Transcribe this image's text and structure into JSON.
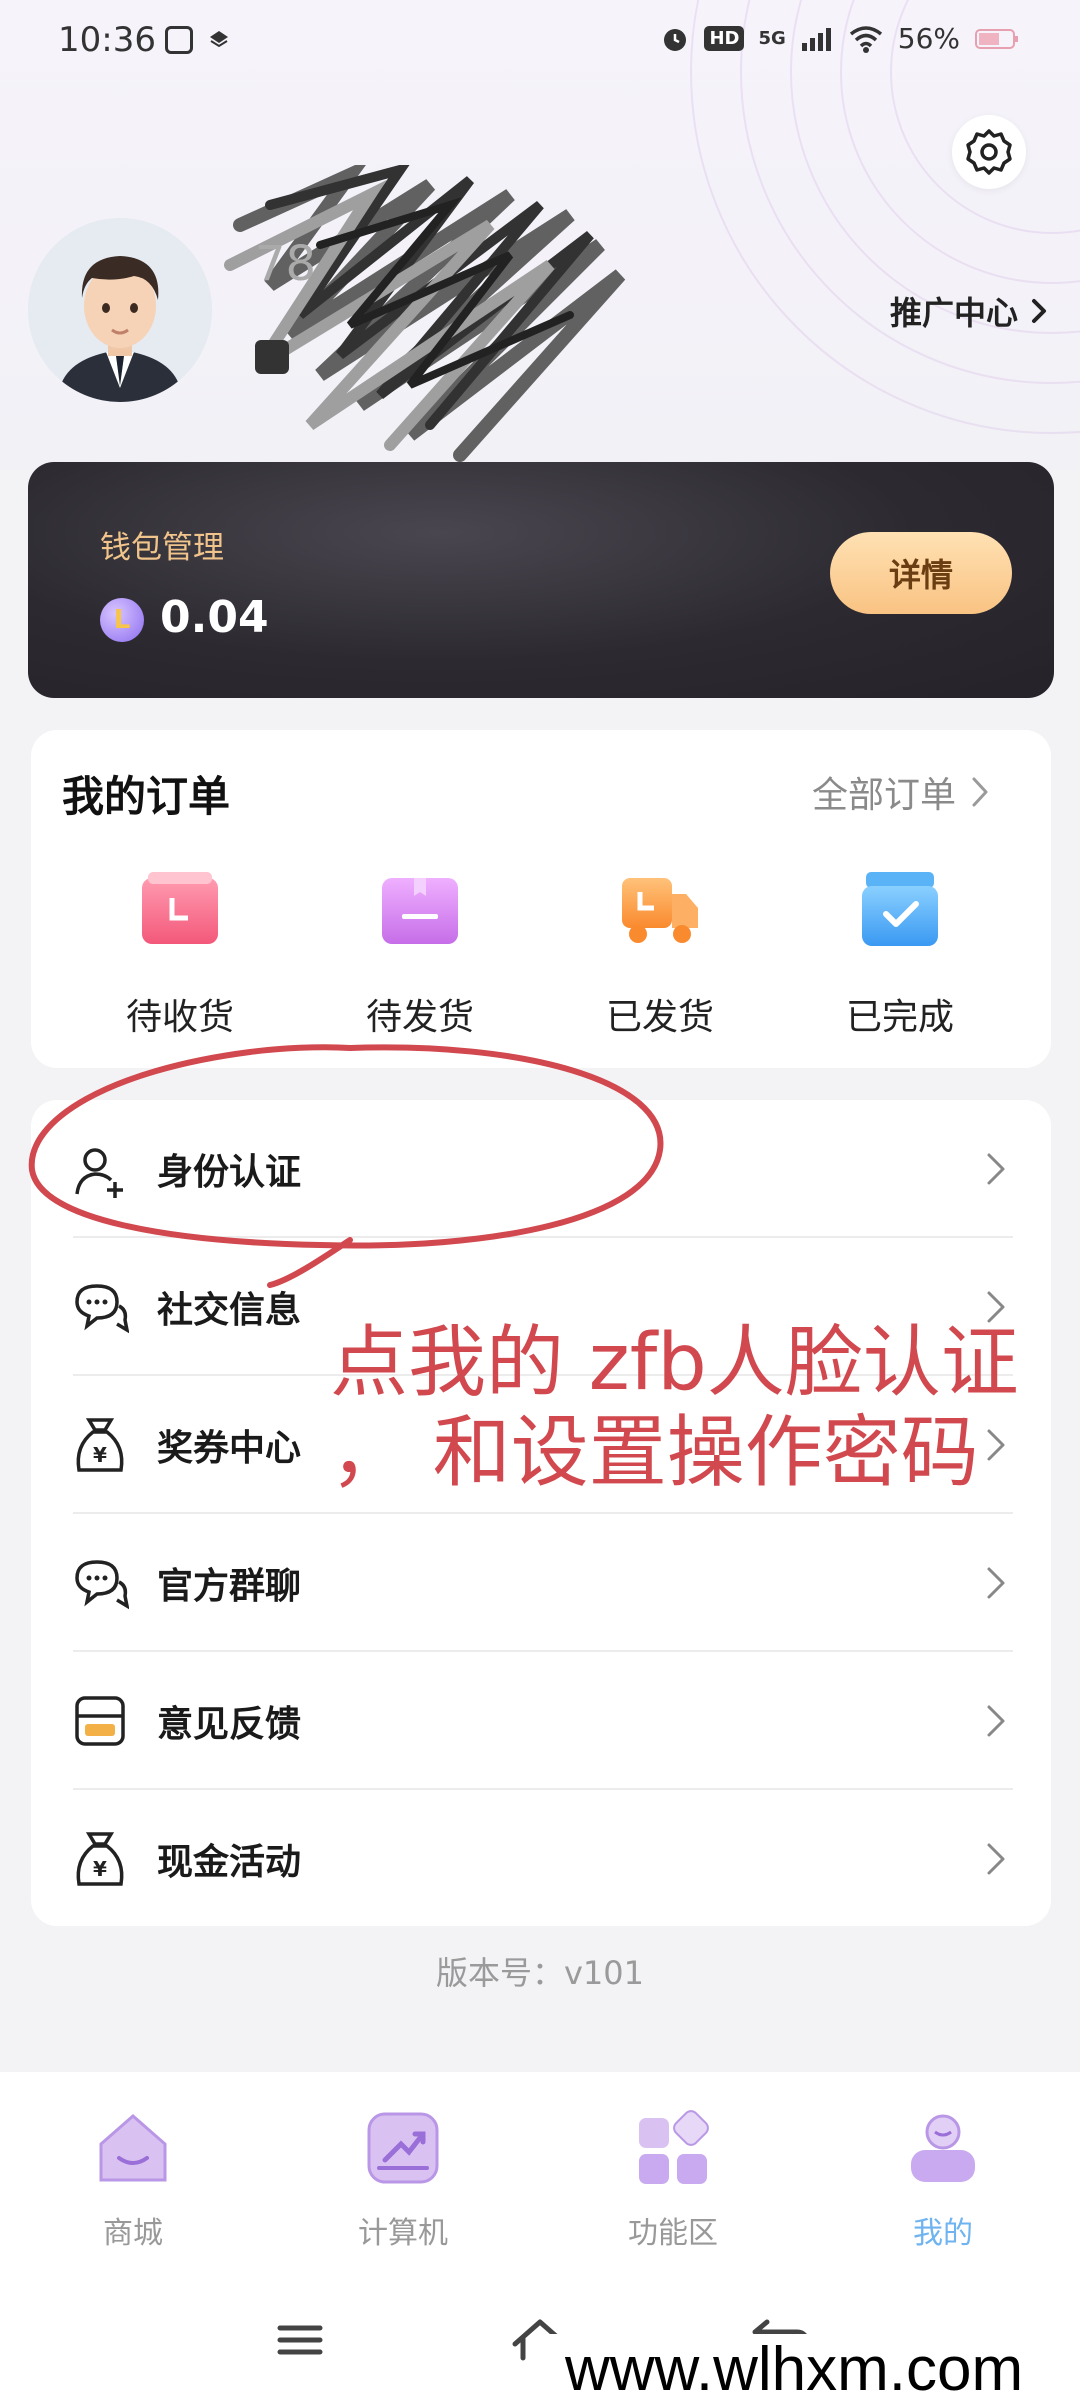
{
  "status_bar": {
    "time": "10:36",
    "network": "5G",
    "battery": "56%"
  },
  "header": {
    "promo_center": "推广中心",
    "settings_icon": "gear-icon"
  },
  "wallet": {
    "label": "钱包管理",
    "balance": "0.04",
    "coin_letter": "L",
    "detail_button": "详情"
  },
  "orders": {
    "title": "我的订单",
    "all_orders": "全部订单",
    "items": [
      {
        "label": "待收货",
        "icon": "pending-receipt-icon",
        "color": "#f7708c"
      },
      {
        "label": "待发货",
        "icon": "pending-shipment-icon",
        "color": "#d27cf0"
      },
      {
        "label": "已发货",
        "icon": "shipped-truck-icon",
        "color": "#fb9a3c"
      },
      {
        "label": "已完成",
        "icon": "completed-box-icon",
        "color": "#48a8f5"
      }
    ]
  },
  "menu": {
    "items": [
      {
        "label": "身份认证",
        "icon": "user-add-icon"
      },
      {
        "label": "社交信息",
        "icon": "chat-bubble-icon"
      },
      {
        "label": "奖券中心",
        "icon": "money-bag-icon"
      },
      {
        "label": "官方群聊",
        "icon": "chat-bubble-icon"
      },
      {
        "label": "意见反馈",
        "icon": "feedback-icon"
      },
      {
        "label": "现金活动",
        "icon": "money-bag-icon"
      }
    ]
  },
  "version": "版本号：v101",
  "bottom_nav": {
    "items": [
      {
        "label": "商城",
        "icon": "home-icon",
        "active": false
      },
      {
        "label": "计算机",
        "icon": "calculator-icon",
        "active": false
      },
      {
        "label": "功能区",
        "icon": "grid-icon",
        "active": false
      },
      {
        "label": "我的",
        "icon": "profile-icon",
        "active": true
      }
    ]
  },
  "annotation": {
    "line1": "点我的 zfb人脸认证",
    "line2": "， 和设置操作密码",
    "color": "#d1484e"
  },
  "watermark": "www.wlhxm.com"
}
